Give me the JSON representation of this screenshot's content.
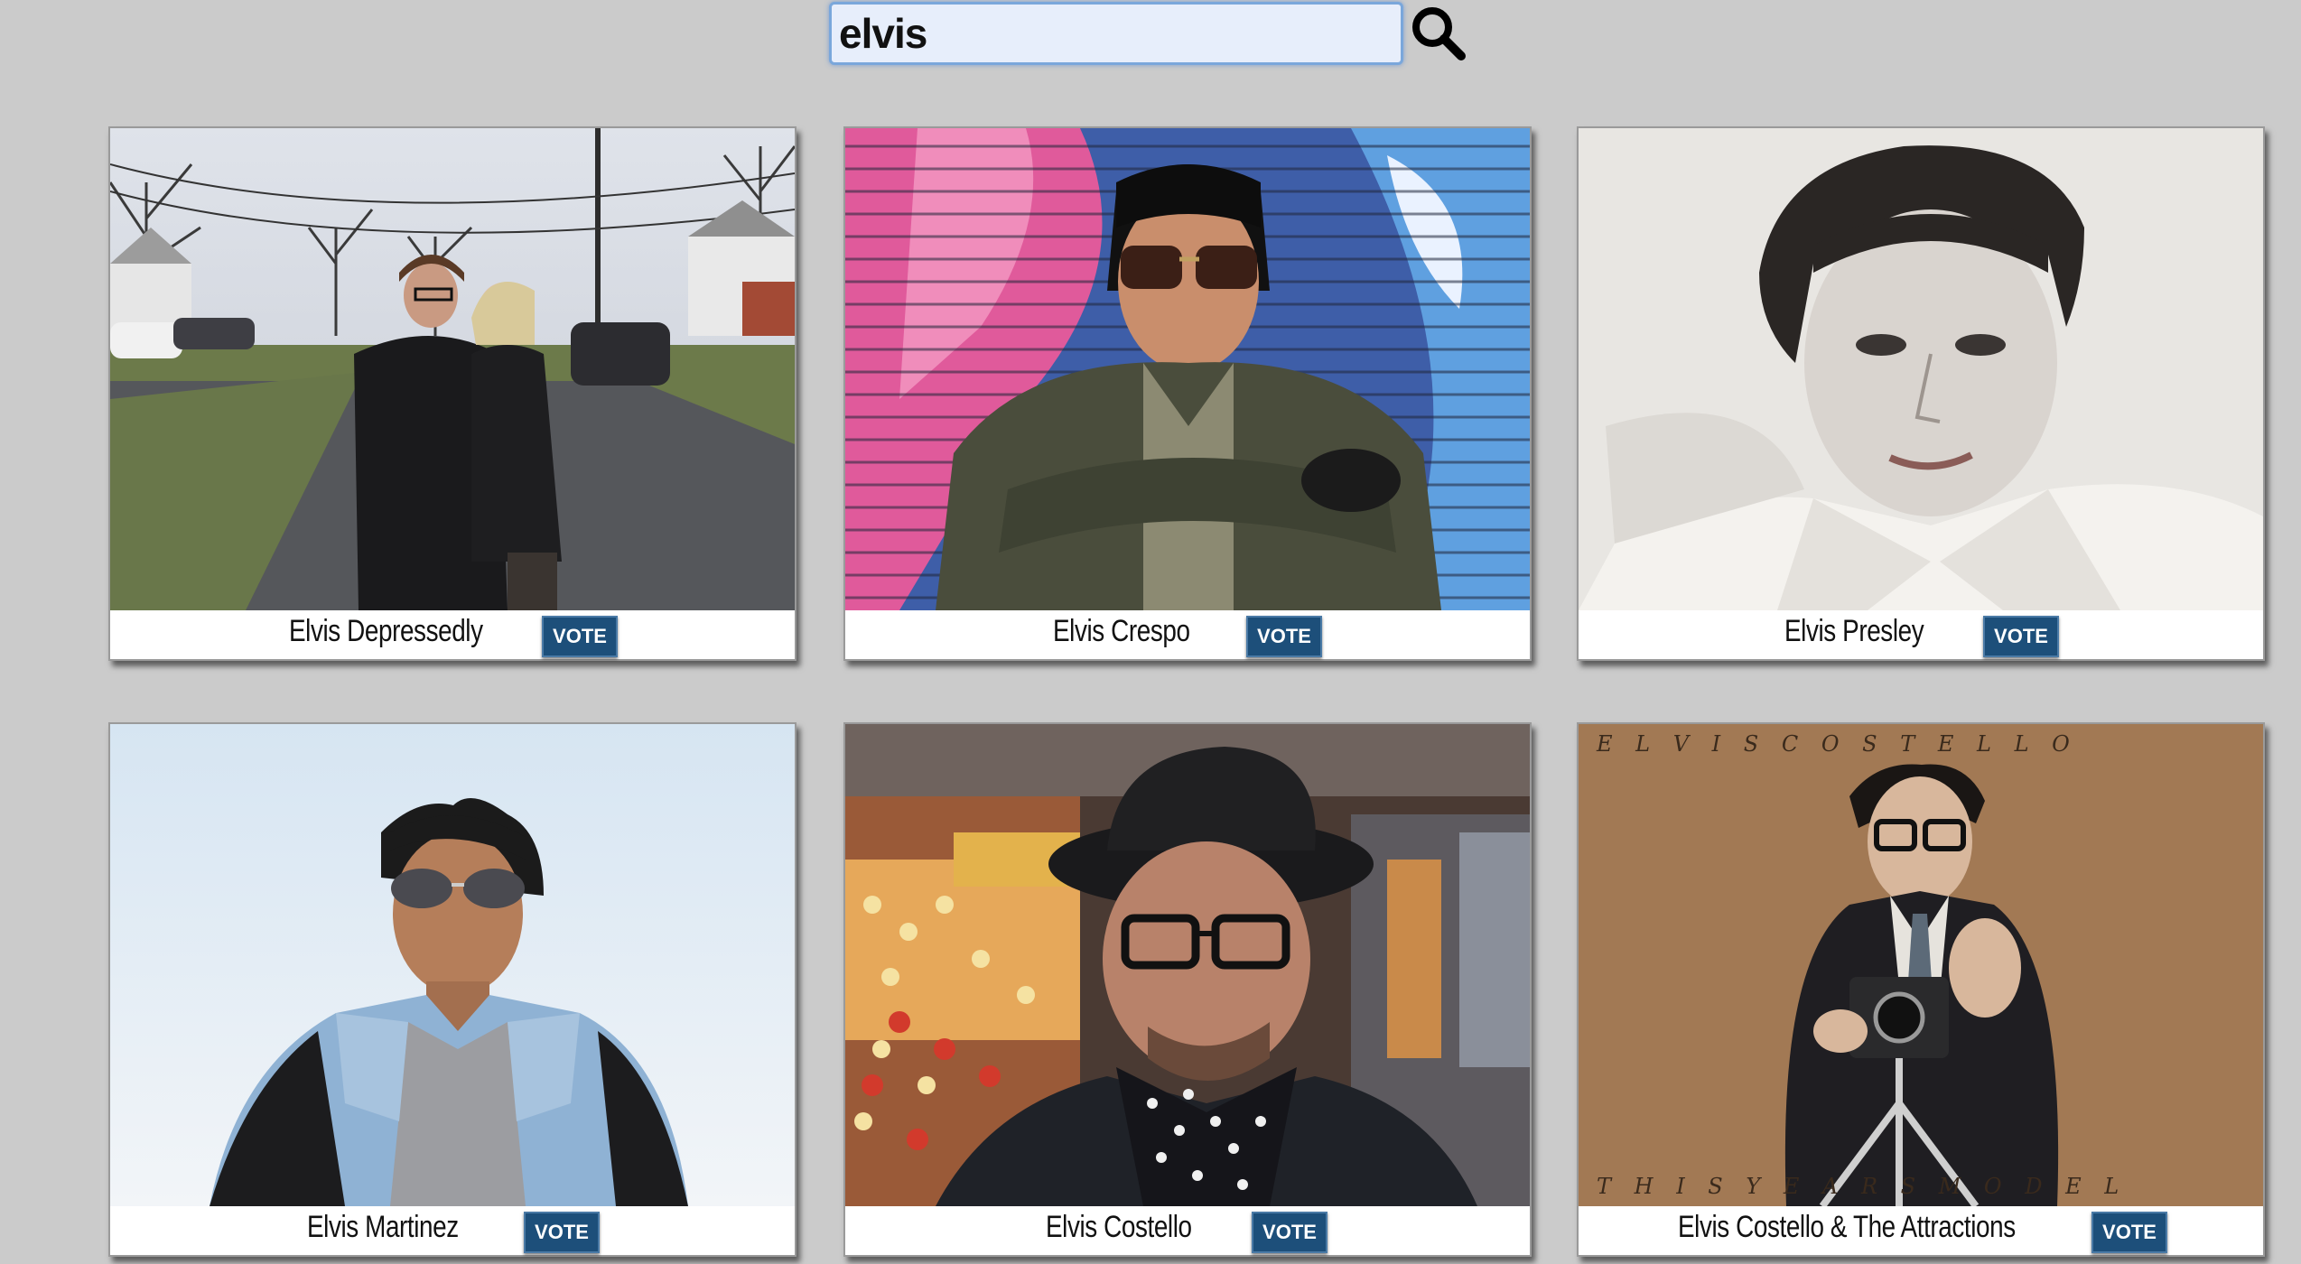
{
  "search": {
    "value": "elvis",
    "icon": "search-icon"
  },
  "results": [
    {
      "name": "Elvis Depressedly",
      "vote_label": "VOTE"
    },
    {
      "name": "Elvis Crespo",
      "vote_label": "VOTE"
    },
    {
      "name": "Elvis Presley",
      "vote_label": "VOTE"
    },
    {
      "name": "Elvis Martinez",
      "vote_label": "VOTE"
    },
    {
      "name": "Elvis Costello",
      "vote_label": "VOTE"
    },
    {
      "name": "Elvis Costello & The Attractions",
      "vote_label": "VOTE"
    }
  ],
  "album_cover": {
    "top_text": "E L V I S   C O S T E L L O",
    "bottom_text": "T H I S   Y E A R S   M O D E L"
  },
  "colors": {
    "page_background": "#cbcbcb",
    "vote_button": "#1d4f7a",
    "search_border": "#7aa7db"
  }
}
